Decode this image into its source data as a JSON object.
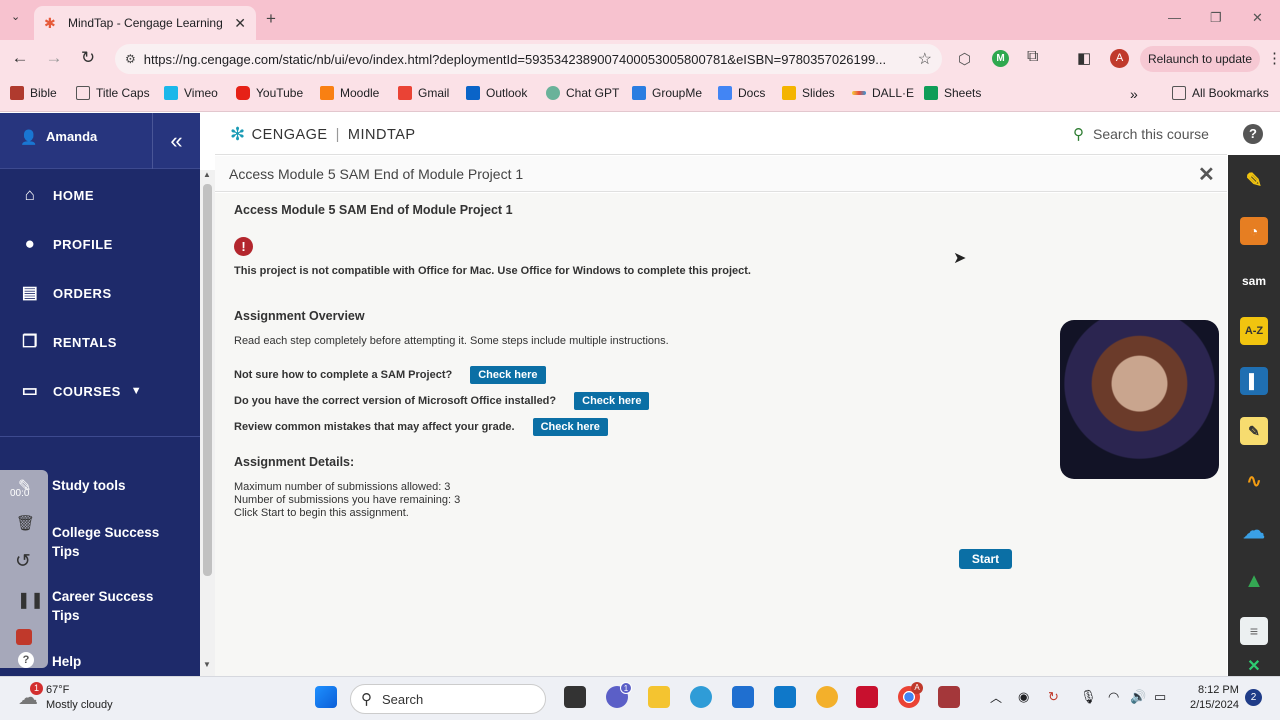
{
  "browser": {
    "tab_title": "MindTap - Cengage Learning",
    "url": "https://ng.cengage.com/static/nb/ui/evo/index.html?deploymentId=5935342389007400053005800781&eISBN=9780357026199...",
    "relaunch_label": "Relaunch to update",
    "profile_initial": "A",
    "bookmarks": [
      "Bible",
      "Title Caps",
      "Vimeo",
      "YouTube",
      "Moodle",
      "Gmail",
      "Outlook",
      "Chat GPT",
      "GroupMe",
      "Docs",
      "Slides",
      "DALL·E",
      "Sheets"
    ],
    "all_bookmarks": "All Bookmarks"
  },
  "sidebar": {
    "user_name": "Amanda",
    "collapse_glyph": "«",
    "nav": [
      "HOME",
      "PROFILE",
      "ORDERS",
      "RENTALS",
      "COURSES"
    ],
    "lower": [
      "Study tools",
      "College Success Tips",
      "Career Success Tips",
      "Help"
    ],
    "timer": "00:0"
  },
  "header": {
    "brand": "CENGAGE",
    "product": "MINDTAP",
    "search_placeholder": "Search this course",
    "help": "?"
  },
  "dialog": {
    "title": "Access Module 5 SAM End of Module Project 1",
    "close": "✕",
    "heading": "Access Module 5 SAM End of Module Project 1",
    "warning_icon": "!",
    "warning": "This project is not compatible with Office for Mac. Use Office for Windows to complete this project.",
    "overview_heading": "Assignment Overview",
    "overview_text": "Read each step completely before attempting it. Some steps include multiple instructions.",
    "questions": [
      {
        "text": "Not sure how to complete a SAM Project?",
        "button": "Check here"
      },
      {
        "text": "Do you have the correct version of Microsoft Office installed?",
        "button": "Check here"
      },
      {
        "text": "Review common mistakes that may affect your grade.",
        "button": "Check here"
      }
    ],
    "details_heading": "Assignment Details:",
    "details": [
      "Maximum number of submissions allowed: 3",
      "Number of submissions you have remaining: 3",
      "Click Start to begin this assignment."
    ],
    "start_label": "Start"
  },
  "rail": [
    "A-Z",
    "sam"
  ],
  "taskbar": {
    "temp": "67°F",
    "condition": "Mostly cloudy",
    "weather_badge": "1",
    "search": "Search",
    "time": "8:12 PM",
    "date": "2/15/2024",
    "notif_count": "2",
    "teams_badge": "1",
    "chrome_badge": "A"
  },
  "colors": {
    "sidebar": "#1e2a6a",
    "accent": "#0b6fa5",
    "tabstrip": "#f7c2cf"
  }
}
